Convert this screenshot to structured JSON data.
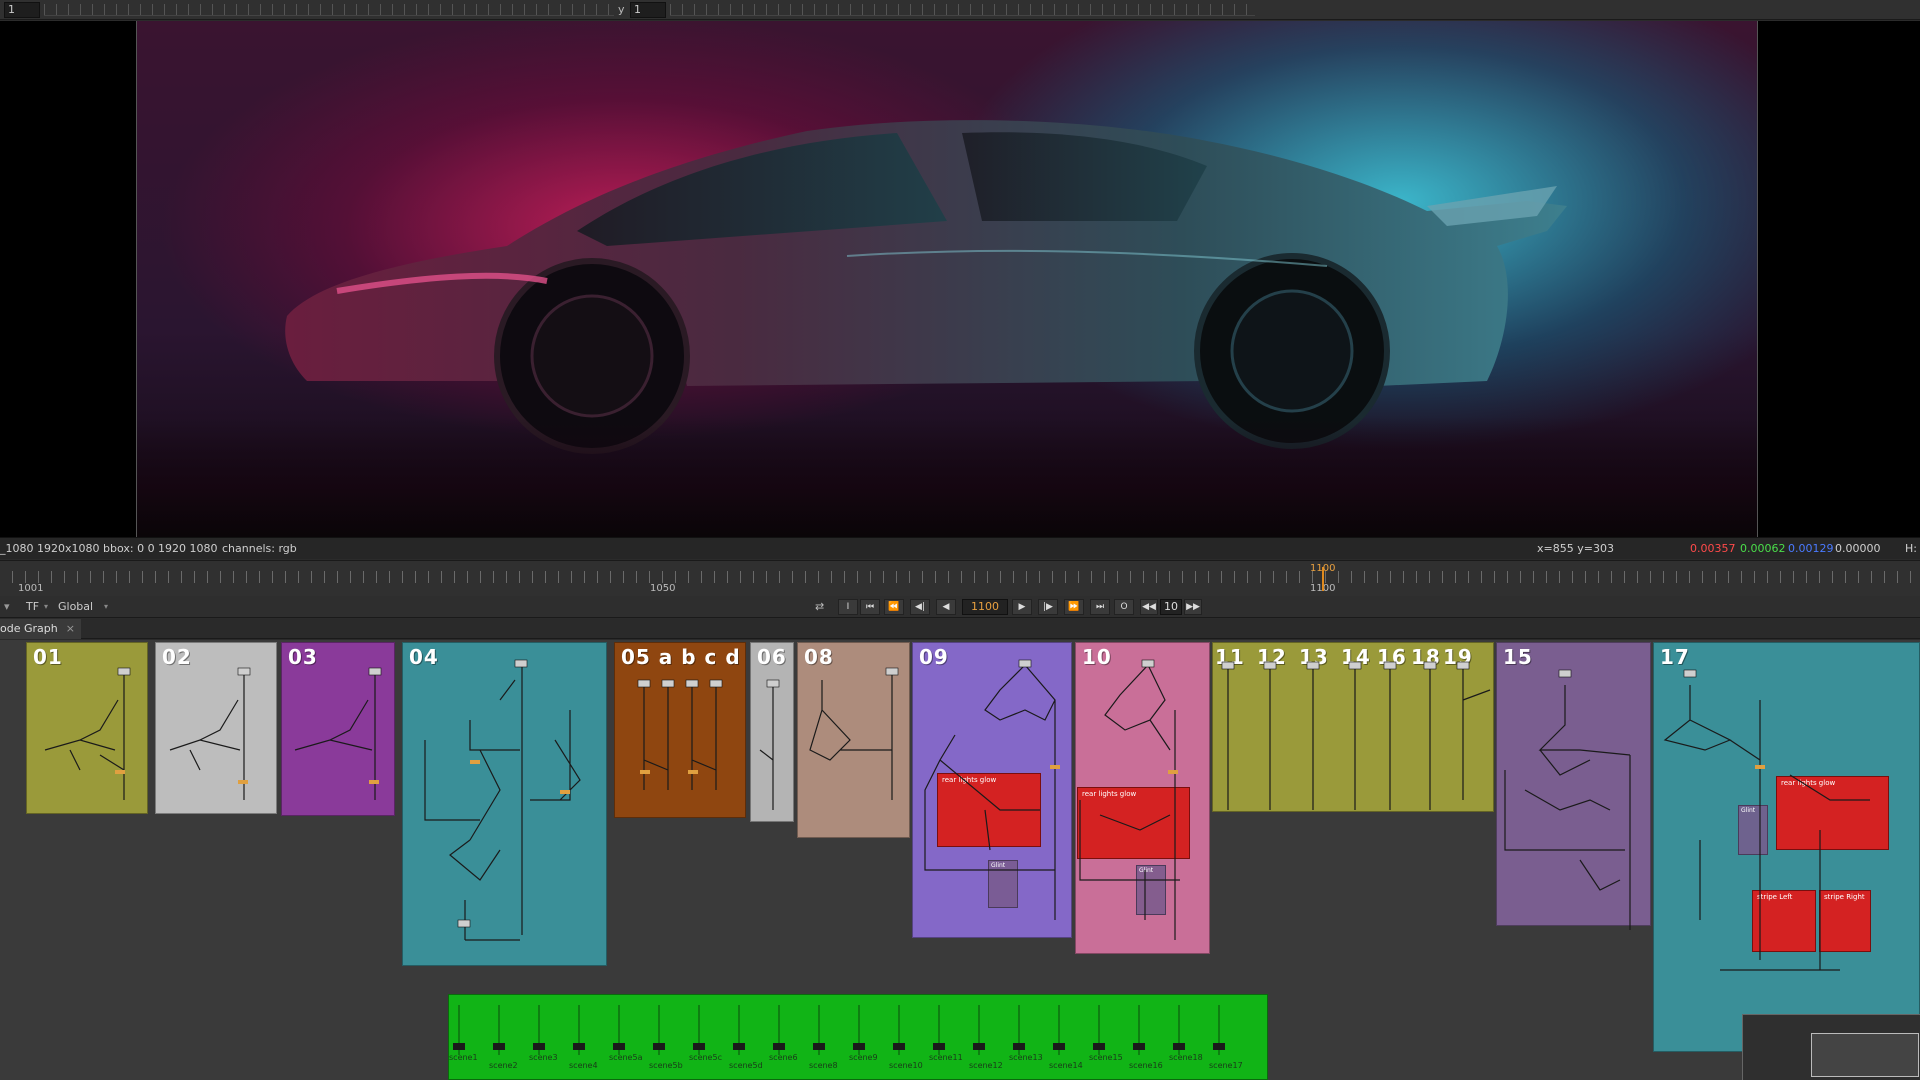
{
  "topbar": {
    "x_field": "1",
    "y_label": "y",
    "y_field": "1"
  },
  "status": {
    "format": "_1080 1920x1080",
    "bbox": "bbox: 0 0 1920 1080",
    "channels": "channels: rgb",
    "coords": "x=855 y=303",
    "r": "0.00357",
    "g": "0.00062",
    "b": "0.00129",
    "a": "0.00000",
    "h": "H:"
  },
  "timeline": {
    "labels": [
      "1001",
      "1050",
      "1100"
    ],
    "cursor_label": "1100"
  },
  "transport": {
    "tf": "TF",
    "scope": "Global",
    "frame": "1100",
    "increment": "10",
    "buttons": [
      "I",
      "⏮",
      "⏪",
      "◀|",
      "◀",
      "▶",
      "|▶",
      "⏩",
      "⏭",
      "O",
      "◀◀",
      "▶▶"
    ]
  },
  "node_graph": {
    "tab_label": "ode Graph",
    "close": "×",
    "backdrops": [
      {
        "label": "01",
        "color": "#9a9a3a"
      },
      {
        "label": "02",
        "color": "#bdbdbd"
      },
      {
        "label": "03",
        "color": "#8a3a9a"
      },
      {
        "label": "04",
        "color": "#3a8f98"
      },
      {
        "label": "05 a b c d",
        "color": "#8f4610"
      },
      {
        "label": "06",
        "color": "#b4b4b4"
      },
      {
        "label": "08",
        "color": "#ad8c7c"
      },
      {
        "label": "09",
        "color": "#8468c8"
      },
      {
        "label": "10",
        "color": "#c96f98"
      },
      {
        "label": "11",
        "color": "#9a9a3a"
      },
      {
        "label": "12",
        "color": "#9a9a3a"
      },
      {
        "label": "13",
        "color": "#9a9a3a"
      },
      {
        "label": "14",
        "color": "#9a9a3a"
      },
      {
        "label": "16",
        "color": "#9a9a3a"
      },
      {
        "label": "18",
        "color": "#9a9a3a"
      },
      {
        "label": "19",
        "color": "#9a9a3a"
      },
      {
        "label": "15",
        "color": "#7a5e90"
      },
      {
        "label": "17",
        "color": "#3a8f98"
      }
    ],
    "sub_backdrops": [
      {
        "label": "rear lights glow"
      },
      {
        "label": "rear lights glow"
      },
      {
        "label": "rear lights glow"
      },
      {
        "label": "stripe Left"
      },
      {
        "label": "stripe Right"
      }
    ],
    "gray_subs": [
      {
        "label": "Glint"
      },
      {
        "label": "Glint"
      },
      {
        "label": "Glint"
      }
    ],
    "scenes": [
      "scene1",
      "scene2",
      "scene3",
      "scene4",
      "scene5a",
      "scene5b",
      "scene5c",
      "scene5d",
      "scene6",
      "scene8",
      "scene9",
      "scene10",
      "scene11",
      "scene12",
      "scene13",
      "scene14",
      "scene15",
      "scene16",
      "scene18",
      "scene17"
    ]
  }
}
